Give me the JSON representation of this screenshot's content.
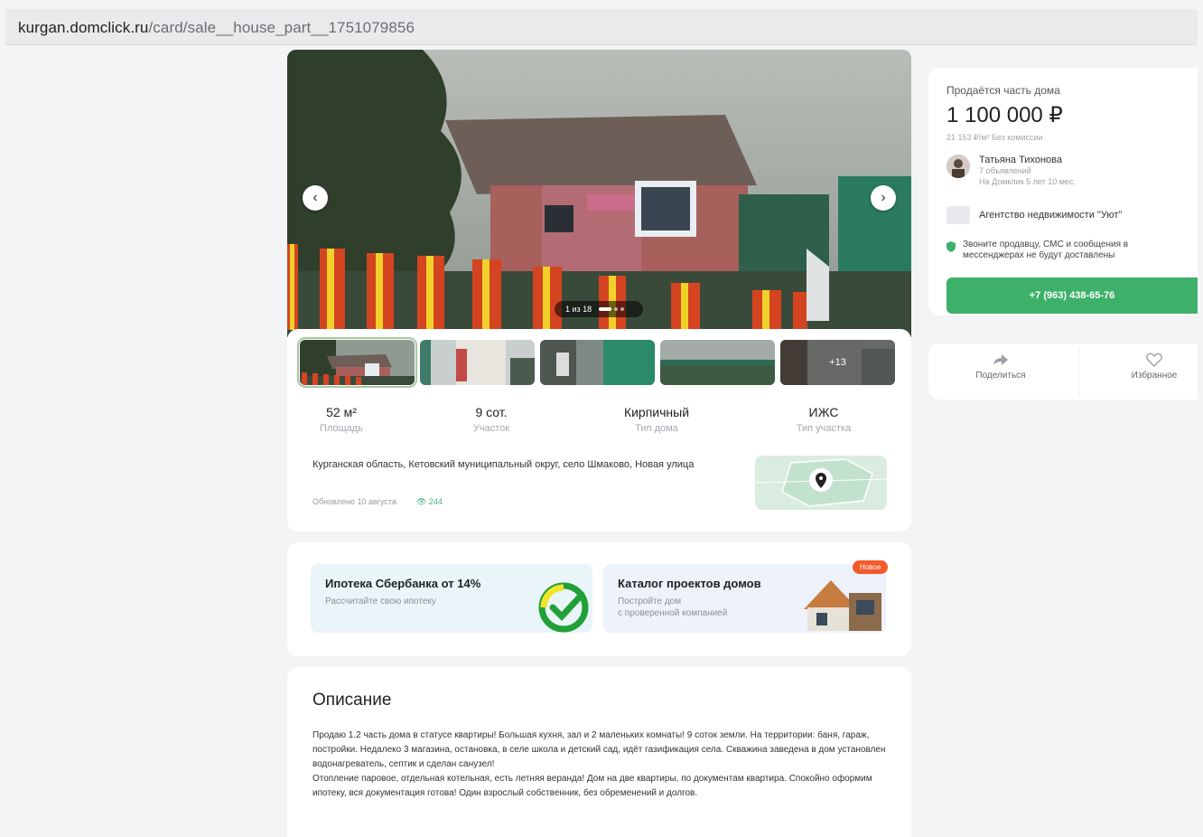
{
  "browser": {
    "url_host": "kurgan.domclick.ru",
    "url_path": "/card/sale__house_part__1751079856"
  },
  "gallery": {
    "counter": "1 из 18",
    "more_label": "+13"
  },
  "facts": [
    {
      "value": "52 м²",
      "label": "Площадь"
    },
    {
      "value": "9 сот.",
      "label": "Участок"
    },
    {
      "value": "Кирпичный",
      "label": "Тип дома"
    },
    {
      "value": "ИЖС",
      "label": "Тип участка"
    }
  ],
  "address": "Курганская область, Кетовский муниципальный округ, село Шмаково, Новая улица",
  "meta": {
    "updated": "Обновлено 10 августа",
    "views": "244"
  },
  "promos": [
    {
      "title": "Ипотека Сбербанка от 14%",
      "subtitle": "Рассчитайте свою ипотеку"
    },
    {
      "title": "Каталог проектов домов",
      "subtitle": "Постройте дом\nс проверенной компанией",
      "badge": "Новое"
    }
  ],
  "description": {
    "heading": "Описание",
    "text": "Продаю 1.2 часть дома в статусе квартиры! Большая кухня, зал и 2 маленьких комнаты! 9 соток земли. На территории: баня, гараж, постройки. Недалеко 3 магазина, остановка, в селе школа и детский сад, идёт газификация села. Скважина заведена в дом установлен водонагреватель, септик и сделан санузел!\nОтопление паровое, отдельная котельная, есть летняя веранда! Дом на две квартиры, по документам квартира. Спокойно оформим ипотеку, вся документация готова! Один взрослый собственник, без обременений и долгов."
  },
  "sidebar": {
    "kind": "Продаётся часть дома",
    "price": "1 100 000 ₽",
    "price_sub": "21 153 ₽/м²  Без комиссии",
    "seller": {
      "name": "Татьяна Тихонова",
      "ads": "7 объявлений",
      "since": "На Домклик 5 лет 10 мес."
    },
    "agency": "Агентство недвижимости \"Уют\"",
    "notice": "Звоните продавцу, СМС и сообщения в мессенджерах не будут доставлены",
    "phone": "+7 (963) 438-65-76",
    "share_label": "Поделиться",
    "favorite_label": "Избранное"
  },
  "colors": {
    "accent_green": "#3db16a",
    "badge_orange": "#f15a2b",
    "views_green": "#45b37a"
  }
}
